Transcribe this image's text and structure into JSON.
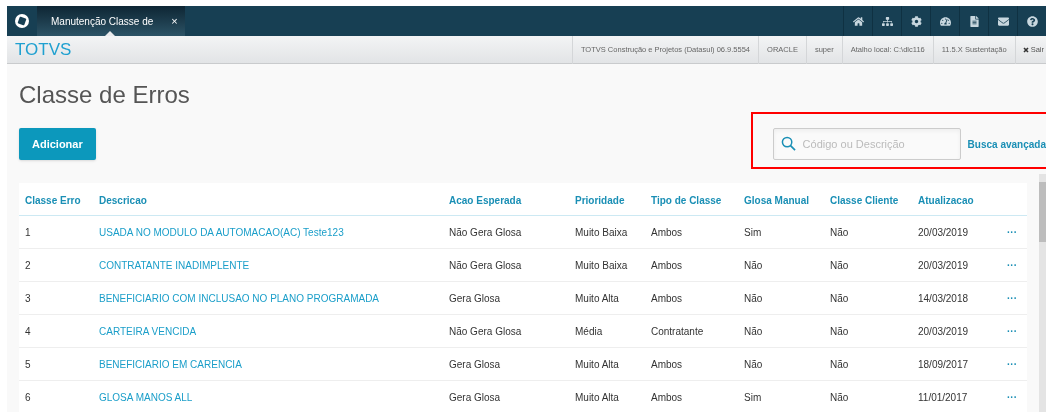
{
  "tab": {
    "label": "Manutenção Classe de",
    "close": "×"
  },
  "nav_icons": [
    {
      "kind": "home"
    },
    {
      "kind": "sitemap"
    },
    {
      "kind": "gear"
    },
    {
      "kind": "dashboard"
    },
    {
      "kind": "file"
    },
    {
      "kind": "mail"
    },
    {
      "kind": "help"
    }
  ],
  "brand": "TOTVS",
  "info_bar": [
    "TOTVS Construção e Projetos (Datasul) 06.9.5554",
    "ORACLE",
    "super",
    "Atalho local: C:\\dlc116",
    "11.5.X Sustentação"
  ],
  "logout": "Sair",
  "page_title": "Classe de Erros",
  "add_button": "Adicionar",
  "search": {
    "placeholder": "Código ou Descrição",
    "advanced_link": "Busca avançada",
    "highlighted": true
  },
  "table": {
    "columns": [
      "Classe Erro",
      "Descricao",
      "Acao Esperada",
      "Prioridade",
      "Tipo de Classe",
      "Glosa Manual",
      "Classe Cliente",
      "Atualizacao"
    ],
    "rows": [
      [
        "1",
        "USADA NO MODULO DA AUTOMACAO(AC) Teste123",
        "Não Gera Glosa",
        "Muito Baixa",
        "Ambos",
        "Sim",
        "Não",
        "20/03/2019"
      ],
      [
        "2",
        "CONTRATANTE INADIMPLENTE",
        "Não Gera Glosa",
        "Muito Baixa",
        "Ambos",
        "Não",
        "Não",
        "20/03/2019"
      ],
      [
        "3",
        "BENEFICIARIO COM INCLUSAO NO PLANO PROGRAMADA",
        "Gera Glosa",
        "Muito Alta",
        "Ambos",
        "Não",
        "Não",
        "14/03/2018"
      ],
      [
        "4",
        "CARTEIRA VENCIDA",
        "Não Gera Glosa",
        "Média",
        "Contratante",
        "Não",
        "Não",
        "20/03/2019"
      ],
      [
        "5",
        "BENEFICIARIO EM CARENCIA",
        "Gera Glosa",
        "Muito Alta",
        "Ambos",
        "Não",
        "Não",
        "18/09/2017"
      ],
      [
        "6",
        "GLOSA MANOS ALL",
        "Gera Glosa",
        "Muito Alta",
        "Ambos",
        "Sim",
        "Não",
        "11/01/2017"
      ]
    ],
    "row_action": "···"
  }
}
